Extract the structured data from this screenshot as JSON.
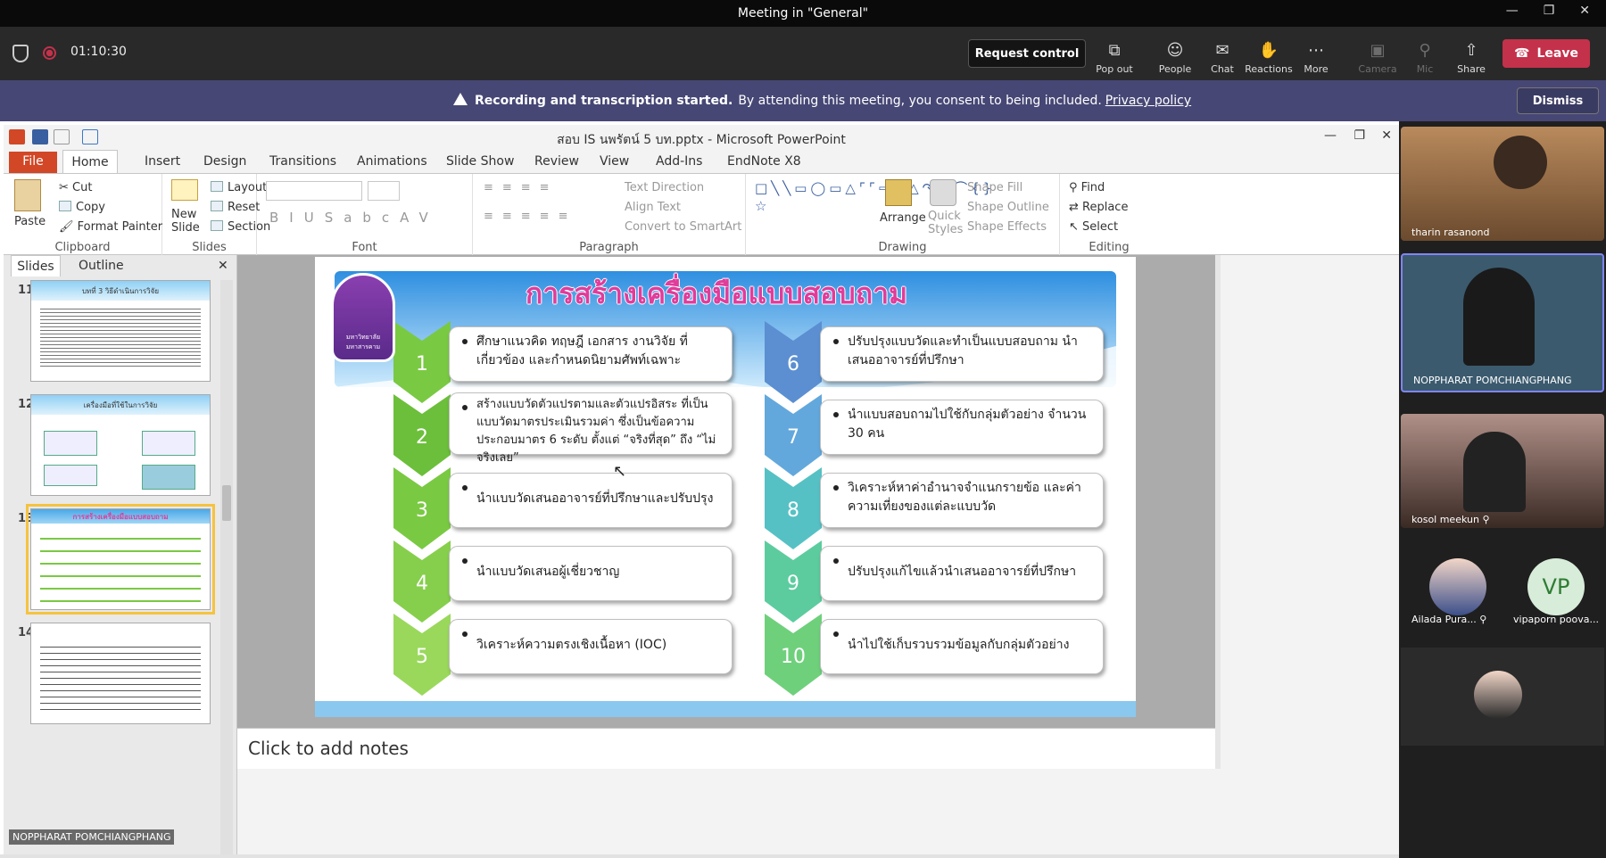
{
  "window": {
    "title": "Meeting in \"General\""
  },
  "meeting": {
    "timer": "01:10:30",
    "request_control": "Request control",
    "toolbar": [
      {
        "label": "Pop out",
        "icon": "pop-out-icon"
      },
      {
        "label": "People",
        "icon": "people-icon"
      },
      {
        "label": "Chat",
        "icon": "chat-icon"
      },
      {
        "label": "Reactions",
        "icon": "reactions-icon"
      },
      {
        "label": "More",
        "icon": "more-icon"
      },
      {
        "label": "Camera",
        "icon": "camera-off-icon"
      },
      {
        "label": "Mic",
        "icon": "mic-off-icon"
      },
      {
        "label": "Share",
        "icon": "share-icon"
      }
    ],
    "leave": "Leave"
  },
  "banner": {
    "bold": "Recording and transcription started.",
    "text": "By attending this meeting, you consent to being included.",
    "link": "Privacy policy",
    "dismiss": "Dismiss"
  },
  "ppt": {
    "title": "สอบ IS นพรัตน์ 5 บท.pptx - Microsoft PowerPoint",
    "tabs": [
      "File",
      "Home",
      "Insert",
      "Design",
      "Transitions",
      "Animations",
      "Slide Show",
      "Review",
      "View",
      "Add-Ins",
      "EndNote X8"
    ],
    "clipboard": {
      "group": "Clipboard",
      "paste": "Paste",
      "cut": "Cut",
      "copy": "Copy",
      "format_painter": "Format Painter"
    },
    "slides_group": {
      "group": "Slides",
      "new_slide": "New Slide",
      "layout": "Layout",
      "reset": "Reset",
      "section": "Section"
    },
    "font_group": {
      "group": "Font"
    },
    "paragraph_group": {
      "group": "Paragraph",
      "text_direction": "Text Direction",
      "align_text": "Align Text",
      "convert": "Convert to SmartArt"
    },
    "drawing_group": {
      "group": "Drawing",
      "arrange": "Arrange",
      "quick_styles": "Quick Styles",
      "shape_fill": "Shape Fill",
      "shape_outline": "Shape Outline",
      "shape_effects": "Shape Effects"
    },
    "editing_group": {
      "group": "Editing",
      "find": "Find",
      "replace": "Replace",
      "select": "Select"
    },
    "panel_tabs": [
      "Slides",
      "Outline"
    ],
    "thumb_numbers": [
      "11",
      "12",
      "13",
      "14"
    ],
    "thumb_titles": [
      "บทที่ 3 วิธีดำเนินการวิจัย",
      "เครื่องมือที่ใช้ในการวิจัย",
      "การสร้างเครื่องมือแบบสอบถาม",
      ""
    ],
    "notes_placeholder": "Click to add notes",
    "presenter_label": "NOPPHARAT POMCHIANGPHANG"
  },
  "slide": {
    "title": "การสร้างเครื่องมือแบบสอบถาม",
    "logo_text": "มหาวิทยาลัยมหาสารคาม",
    "steps": [
      {
        "num": "1",
        "text": "ศึกษาแนวคิด ทฤษฎี เอกสาร งานวิจัย ที่เกี่ยวข้อง และกำหนดนิยามศัพท์เฉพาะ"
      },
      {
        "num": "2",
        "text": "สร้างแบบวัดตัวแปรตามและตัวแปรอิสระ ที่เป็นแบบวัดมาตรประเมินรวมค่า ซึ่งเป็นข้อความประกอบมาตร 6 ระดับ ตั้งแต่ “จริงที่สุด” ถึง “ไม่จริงเลย”"
      },
      {
        "num": "3",
        "text": "นำแบบวัดเสนออาจารย์ที่ปรึกษาและปรับปรุง"
      },
      {
        "num": "4",
        "text": "นำแบบวัดเสนอผู้เชี่ยวชาญ"
      },
      {
        "num": "5",
        "text": "วิเคราะห์ความตรงเชิงเนื้อหา (IOC)"
      },
      {
        "num": "6",
        "text": "ปรับปรุงแบบวัดและทำเป็นแบบสอบถาม นำเสนออาจารย์ที่ปรึกษา"
      },
      {
        "num": "7",
        "text": "นำแบบสอบถามไปใช้กับกลุ่มตัวอย่าง จำนวน 30 คน"
      },
      {
        "num": "8",
        "text": "วิเคราะห์หาค่าอำนาจจำแนกรายข้อ และค่าความเที่ยงของแต่ละแบบวัด"
      },
      {
        "num": "9",
        "text": "ปรับปรุงแก้ไขแล้วนำเสนออาจารย์ที่ปรึกษา"
      },
      {
        "num": "10",
        "text": "นำไปใช้เก็บรวบรวมข้อมูลกับกลุ่มตัวอย่าง"
      }
    ]
  },
  "participants": [
    {
      "name": "tharin rasanond"
    },
    {
      "name": "NOPPHARAT POMCHIANGPHANG"
    },
    {
      "name": "kosol meekun"
    },
    {
      "name": "Ailada Pura..."
    },
    {
      "name": "vipaporn poova...",
      "initials": "VP"
    }
  ],
  "colors": {
    "accent": "#c4314b",
    "banner": "#464775",
    "ppt_file": "#d24726",
    "title_pink": "#e03c9a",
    "chev_green": "#7ac943",
    "chev_blue": "#5b8fd1"
  }
}
